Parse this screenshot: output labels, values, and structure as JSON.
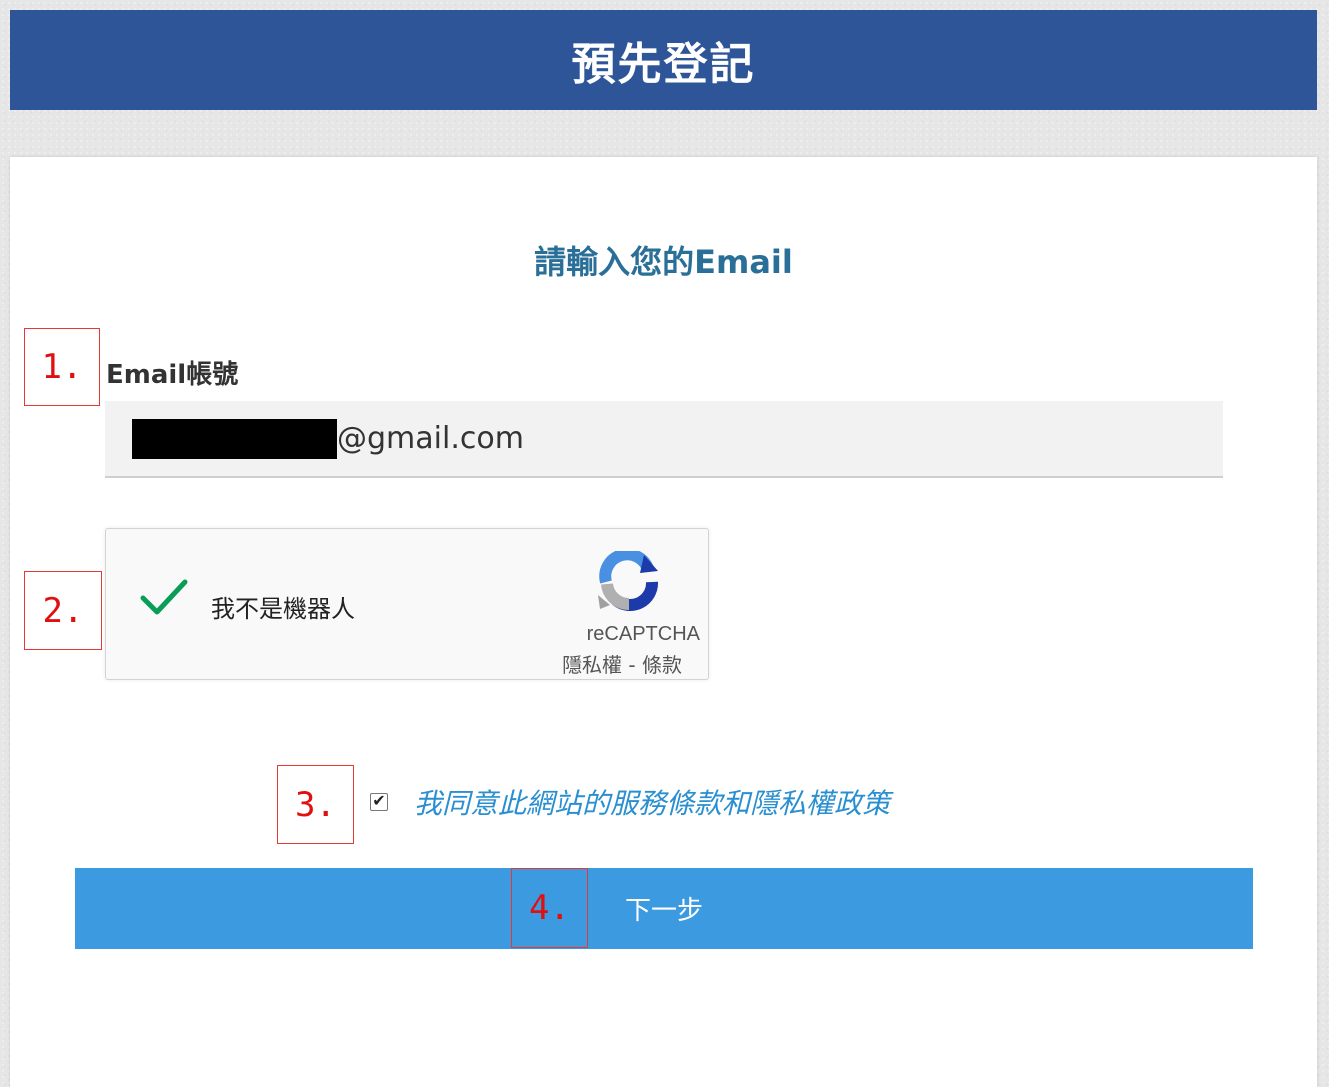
{
  "header": {
    "title": "預先登記"
  },
  "form": {
    "heading": "請輸入您的Email",
    "email_label": "Email帳號",
    "email_value": "@gmail.com",
    "recaptcha": {
      "label": "我不是機器人",
      "brand": "reCAPTCHA",
      "links": "隱私權 - 條款",
      "checked": true,
      "icon": "recaptcha-logo-icon"
    },
    "agree": {
      "checked": true,
      "label": "我同意此網站的服務條款和隱私權政策"
    },
    "next_button": "下一步"
  },
  "annotations": {
    "a1": "1.",
    "a2": "2.",
    "a3": "3.",
    "a4": "4."
  },
  "colors": {
    "header_bg": "#2d5597",
    "heading_text": "#2a6f97",
    "agree_text": "#2a8fd0",
    "button_bg": "#3b9ae0",
    "annotation_red": "#e01010",
    "check_green": "#0a9d58"
  }
}
